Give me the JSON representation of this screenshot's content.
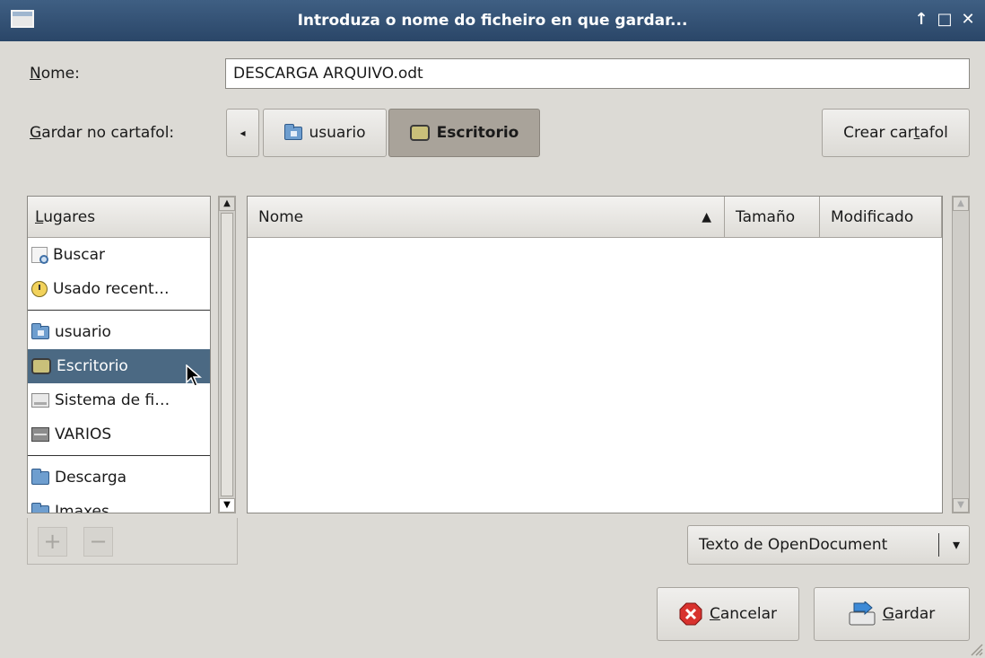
{
  "window": {
    "title": "Introduza o nome do ficheiro en que gardar...",
    "btn_up": "↑",
    "btn_max": "□",
    "btn_close": "✕"
  },
  "name_row": {
    "label_mnemonic": "N",
    "label_rest": "ome:",
    "value": "DESCARGA ARQUIVO.odt"
  },
  "folder_row": {
    "label_mnemonic": "G",
    "label_rest": "ardar no cartafol:",
    "back_arrow": "◂",
    "path": [
      {
        "label": "usuario",
        "icon": "home-folder-icon"
      },
      {
        "label": "Escritorio",
        "icon": "desktop-icon",
        "active": true
      }
    ],
    "create_pre": "Crear car",
    "create_mnemonic": "t",
    "create_post": "afol"
  },
  "places": {
    "header_mnemonic": "L",
    "header_rest": "ugares",
    "items": [
      {
        "label": "Buscar",
        "icon": "search-icon"
      },
      {
        "label": "Usado recent…",
        "icon": "recent-clock-icon"
      },
      {
        "label": "usuario",
        "icon": "home-folder-icon"
      },
      {
        "label": "Escritorio",
        "icon": "desktop-icon",
        "selected": true
      },
      {
        "label": "Sistema de fi…",
        "icon": "drive-icon"
      },
      {
        "label": "VARIOS",
        "icon": "volume-icon"
      },
      {
        "label": "Descarga",
        "icon": "folder-icon"
      },
      {
        "label": "Imaxes",
        "icon": "folder-icon"
      }
    ],
    "add": "+",
    "remove": "−"
  },
  "files": {
    "columns": [
      {
        "label": "Nome",
        "sort": "▲"
      },
      {
        "label": "Tamaño"
      },
      {
        "label": "Modificado"
      }
    ],
    "rows": []
  },
  "filter": {
    "value": "Texto de OpenDocument",
    "arrow": "▾"
  },
  "actions": {
    "cancel_mnemonic": "C",
    "cancel_rest": "ancelar",
    "save_mnemonic": "G",
    "save_rest": "ardar"
  },
  "colors": {
    "title_bar": "#2f4d70",
    "selection": "#4b6983",
    "window_bg": "#dcdad5"
  }
}
